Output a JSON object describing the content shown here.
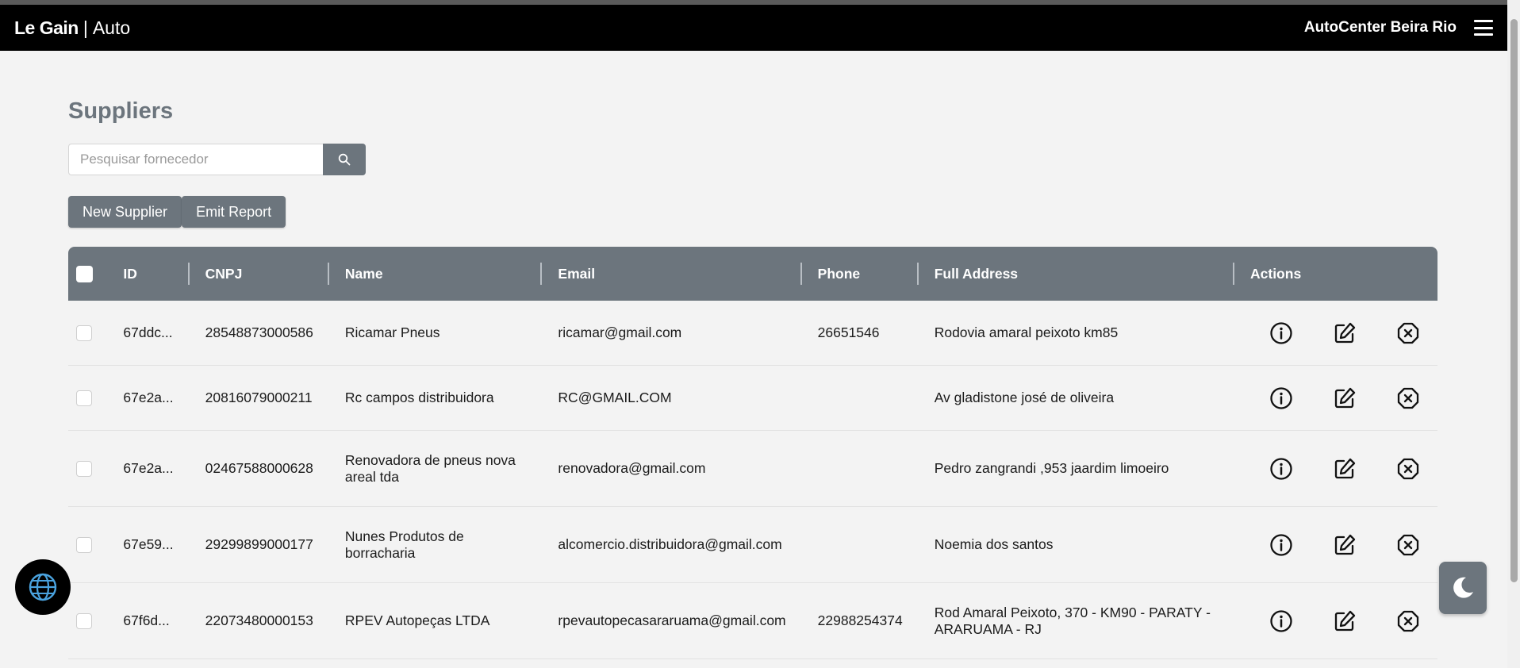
{
  "navbar": {
    "brand_bold": "Le Gain",
    "brand_sep": "|",
    "brand_light": "Auto",
    "company": "AutoCenter Beira Rio"
  },
  "page": {
    "title": "Suppliers",
    "search_placeholder": "Pesquisar fornecedor",
    "new_supplier_label": "New Supplier",
    "emit_report_label": "Emit Report"
  },
  "table": {
    "columns": [
      "ID",
      "CNPJ",
      "Name",
      "Email",
      "Phone",
      "Full Address",
      "Actions"
    ],
    "rows": [
      {
        "id": "67ddc...",
        "cnpj": "28548873000586",
        "name": "Ricamar Pneus",
        "email": "ricamar@gmail.com",
        "phone": "26651546",
        "address": "Rodovia amaral peixoto km85"
      },
      {
        "id": "67e2a...",
        "cnpj": "20816079000211",
        "name": "Rc campos distribuidora",
        "email": "RC@GMAIL.COM",
        "phone": "",
        "address": "Av gladistone josé de oliveira"
      },
      {
        "id": "67e2a...",
        "cnpj": "02467588000628",
        "name": "Renovadora de pneus nova areal tda",
        "email": "renovadora@gmail.com",
        "phone": "",
        "address": "Pedro zangrandi ,953 jaardim limoeiro"
      },
      {
        "id": "67e59...",
        "cnpj": "29299899000177",
        "name": "Nunes Produtos de borracharia",
        "email": "alcomercio.distribuidora@gmail.com",
        "phone": "",
        "address": "Noemia dos santos"
      },
      {
        "id": "67f6d...",
        "cnpj": "22073480000153",
        "name": "RPEV Autopeças LTDA",
        "email": "rpevautopecasararuama@gmail.com",
        "phone": "22988254374",
        "address": "Rod Amaral Peixoto, 370 - KM90 - PARATY - ARARUAMA - RJ"
      }
    ]
  },
  "icons": {
    "search": "search-icon",
    "info": "info-icon",
    "edit": "edit-icon",
    "delete": "delete-icon",
    "globe": "globe-icon",
    "theme": "moon-icon",
    "menu": "hamburger-menu-icon"
  },
  "colors": {
    "navbar": "#000000",
    "accent": "#6c757d",
    "background": "#f3f3f3",
    "globe": "#4aa3df"
  }
}
